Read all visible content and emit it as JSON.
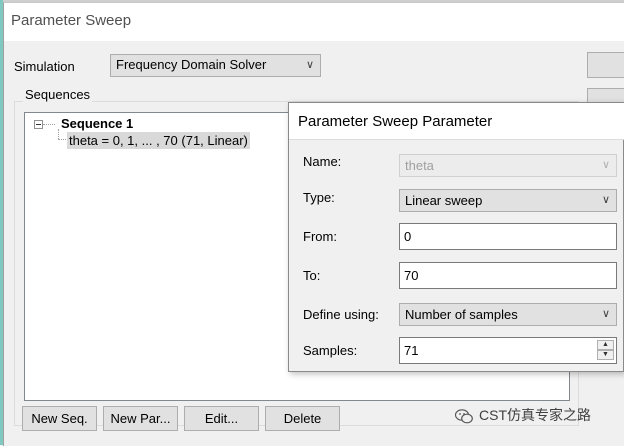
{
  "main_dialog": {
    "title": "Parameter Sweep",
    "simulation_label": "Simulation",
    "simulation_value": "Frequency Domain Solver",
    "sequences_label": "Sequences",
    "tree": {
      "sequence_name": "Sequence 1",
      "parameter_entry": "theta = 0, 1, ... , 70 (71, Linear)"
    },
    "buttons": {
      "new_seq": "New Seq.",
      "new_par": "New Par...",
      "edit": "Edit...",
      "delete": "Delete"
    }
  },
  "popup": {
    "title": "Parameter Sweep Parameter",
    "name_label": "Name:",
    "name_value": "theta",
    "type_label": "Type:",
    "type_value": "Linear sweep",
    "from_label": "From:",
    "from_value": "0",
    "to_label": "To:",
    "to_value": "70",
    "define_label": "Define using:",
    "define_value": "Number of samples",
    "samples_label": "Samples:",
    "samples_value": "71"
  },
  "watermark": {
    "text": "CST仿真专家之路"
  },
  "colors": {
    "button_face": "#e1e1e1",
    "selection": "#d9d9d9",
    "title_bg": "#ffffff"
  }
}
